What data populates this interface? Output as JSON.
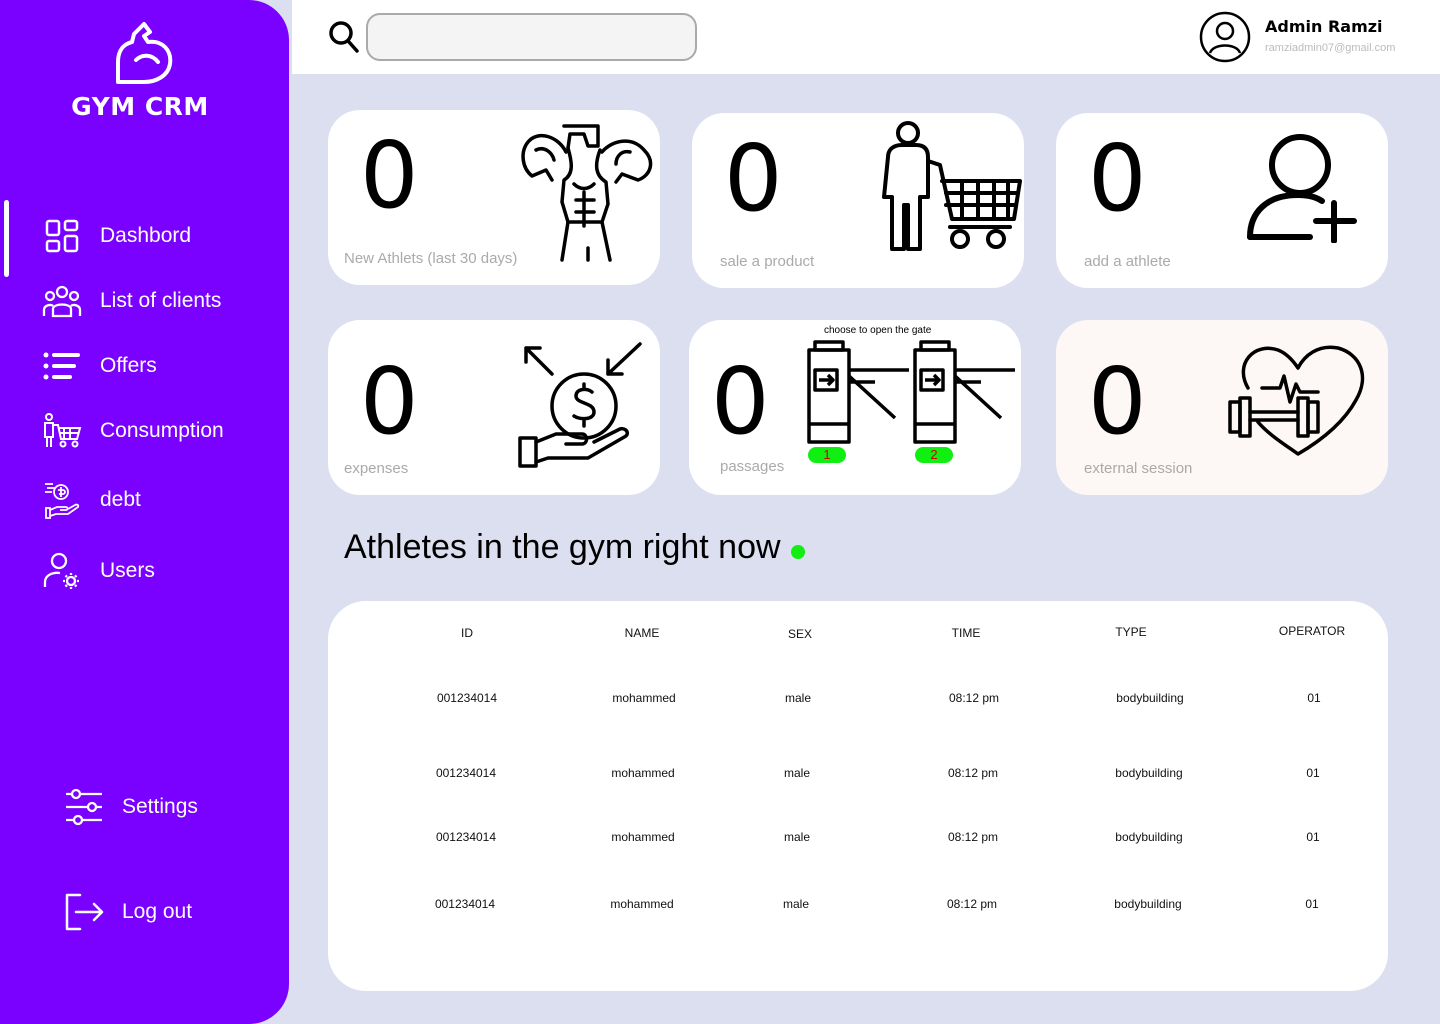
{
  "app": {
    "name": "GYM CRM"
  },
  "sidebar": {
    "items": [
      {
        "label": "Dashbord",
        "icon": "dashboard-grid-icon"
      },
      {
        "label": "List of clients",
        "icon": "clients-group-icon"
      },
      {
        "label": "Offers",
        "icon": "list-icon"
      },
      {
        "label": "Consumption",
        "icon": "shopping-cart-person-icon"
      },
      {
        "label": "debt",
        "icon": "hand-money-icon"
      },
      {
        "label": "Users",
        "icon": "user-gear-icon"
      }
    ],
    "settings_label": "Settings",
    "logout_label": "Log out"
  },
  "header": {
    "search": {
      "placeholder": "",
      "value": ""
    },
    "user": {
      "name": "Admin Ramzi",
      "email": "ramziadmin07@gmail.com"
    }
  },
  "cards": [
    {
      "value": "0",
      "label": "New Athlets (last 30 days)",
      "icon": "bodybuilder-icon"
    },
    {
      "value": "0",
      "label": "sale a product",
      "icon": "person-cart-icon"
    },
    {
      "value": "0",
      "label": "add a athlete",
      "icon": "add-user-icon"
    },
    {
      "value": "0",
      "label": "expenses",
      "icon": "hand-coin-icon"
    },
    {
      "value": "0",
      "label": "passages",
      "icon": "turnstile-icon",
      "gate_hint": "choose to open the gate",
      "gates": [
        "1",
        "2"
      ]
    },
    {
      "value": "0",
      "label": "external session",
      "icon": "heart-dumbbell-icon"
    }
  ],
  "section": {
    "title": "Athletes in the gym right now",
    "status_color": "#11ee11"
  },
  "table": {
    "columns": [
      "ID",
      "NAME",
      "SEX",
      "TIME",
      "TYPE",
      "OPERATOR"
    ],
    "rows": [
      [
        "001234014",
        "mohammed",
        "male",
        "08:12 pm",
        "bodybuilding",
        "01"
      ],
      [
        "001234014",
        "mohammed",
        "male",
        "08:12 pm",
        "bodybuilding",
        "01"
      ],
      [
        "001234014",
        "mohammed",
        "male",
        "08:12 pm",
        "bodybuilding",
        "01"
      ],
      [
        "001234014",
        "mohammed",
        "male",
        "08:12 pm",
        "bodybuilding",
        "01"
      ]
    ]
  },
  "colors": {
    "sidebar": "#7a00ff",
    "background": "#dcdff0",
    "accent_green": "#11ee11"
  }
}
